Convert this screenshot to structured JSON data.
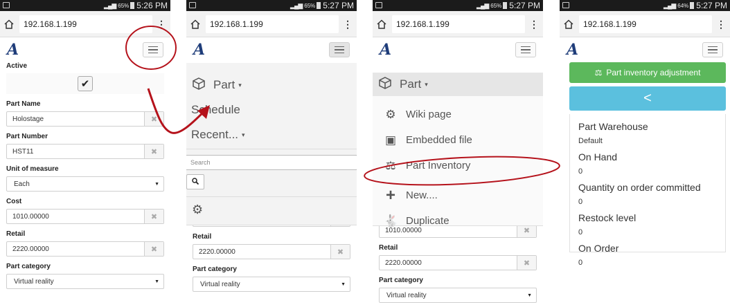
{
  "screens": [
    {
      "status": {
        "battery": "65%",
        "time": "5:26 PM"
      }
    },
    {
      "status": {
        "battery": "65%",
        "time": "5:27 PM"
      }
    },
    {
      "status": {
        "battery": "65%",
        "time": "5:27 PM"
      }
    },
    {
      "status": {
        "battery": "64%",
        "time": "5:27 PM"
      }
    }
  ],
  "browser": {
    "url": "192.168.1.199"
  },
  "app": {
    "logo": "A"
  },
  "form": {
    "active_label": "Active",
    "part_name_label": "Part Name",
    "part_name_value": "Holostage",
    "part_number_label": "Part Number",
    "part_number_value": "HST11",
    "uom_label": "Unit of measure",
    "uom_value": "Each",
    "cost_label": "Cost",
    "cost_value": "1010.00000",
    "retail_label": "Retail",
    "retail_value": "2220.00000",
    "category_label": "Part category",
    "category_value": "Virtual reality",
    "clear_glyph": "✖"
  },
  "nav_menu": {
    "part": "Part",
    "schedule": "Schedule",
    "recent": "Recent...",
    "search_placeholder": "Search"
  },
  "part_menu": {
    "title": "Part",
    "items": [
      "Wiki page",
      "Embedded file",
      "Part Inventory",
      "New....",
      "Duplicate"
    ]
  },
  "inventory": {
    "adjust_button": "Part inventory adjustment",
    "back_glyph": "<",
    "fields": [
      {
        "label": "Part Warehouse",
        "value": "Default"
      },
      {
        "label": "On Hand",
        "value": "0"
      },
      {
        "label": "Quantity on order committed",
        "value": "0"
      },
      {
        "label": "Restock level",
        "value": "0"
      },
      {
        "label": "On Order",
        "value": "0"
      }
    ]
  },
  "colors": {
    "annotation": "#b5121b",
    "green": "#5cb85c",
    "blue": "#5bc0de",
    "logo": "#1f3d7a"
  },
  "icons": [
    "home-icon",
    "menu-dots-icon",
    "hamburger-icon",
    "cube-icon",
    "gear-icon",
    "search-icon",
    "wiki-icon",
    "file-icon",
    "inventory-icon",
    "plus-icon",
    "rabbit-icon",
    "scale-icon",
    "chevron-left-icon"
  ]
}
